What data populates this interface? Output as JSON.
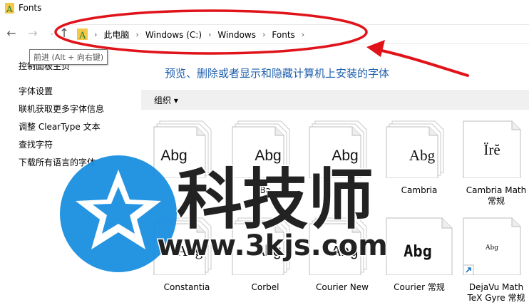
{
  "window": {
    "title": "Fonts"
  },
  "nav": {
    "back_glyph": "←",
    "forward_glyph": "→",
    "recent_glyph": "⌄",
    "up_glyph": "↑"
  },
  "address": {
    "crumbs": [
      "此电脑",
      "Windows (C:)",
      "Windows",
      "Fonts"
    ],
    "separator": "›"
  },
  "tooltip": {
    "text": "前进 (Alt + 向右键)"
  },
  "sidebar": {
    "home_link": "控制面板主页",
    "links": [
      "字体设置",
      "联机获取更多字体信息",
      "调整 ClearType 文本",
      "查找字符",
      "下载所有语言的字体"
    ]
  },
  "main": {
    "heading": "预览、删除或者显示和隐藏计算机上安装的字体",
    "organize_label": "组织 ▾"
  },
  "fonts": [
    {
      "preview": "Abg",
      "label": "",
      "label2": ""
    },
    {
      "preview": "Abg",
      "label": "Ba",
      "label2": ""
    },
    {
      "preview": "Abg",
      "label": "",
      "label2": ""
    },
    {
      "preview": "Abg",
      "label": "Cambria",
      "label2": ""
    },
    {
      "preview": "Ïrĕ",
      "label": "Cambria Math",
      "label2": "常规"
    },
    {
      "preview": "Abg",
      "label": "Constantia",
      "label2": ""
    },
    {
      "preview": "Abg",
      "label": "Corbel",
      "label2": ""
    },
    {
      "preview": "Abg",
      "label": "Courier New",
      "label2": ""
    },
    {
      "preview": "Abg",
      "label": "Courier 常规",
      "label2": ""
    },
    {
      "preview": "Abg",
      "label": "DejaVu Math",
      "label2": "TeX Gyre 常规"
    }
  ],
  "watermark": {
    "text": "科技师",
    "url": "www.3kjs.com"
  },
  "colors": {
    "link": "#1e5fae",
    "annotation": "#e0131a",
    "watermark": "#1a8fe0"
  }
}
